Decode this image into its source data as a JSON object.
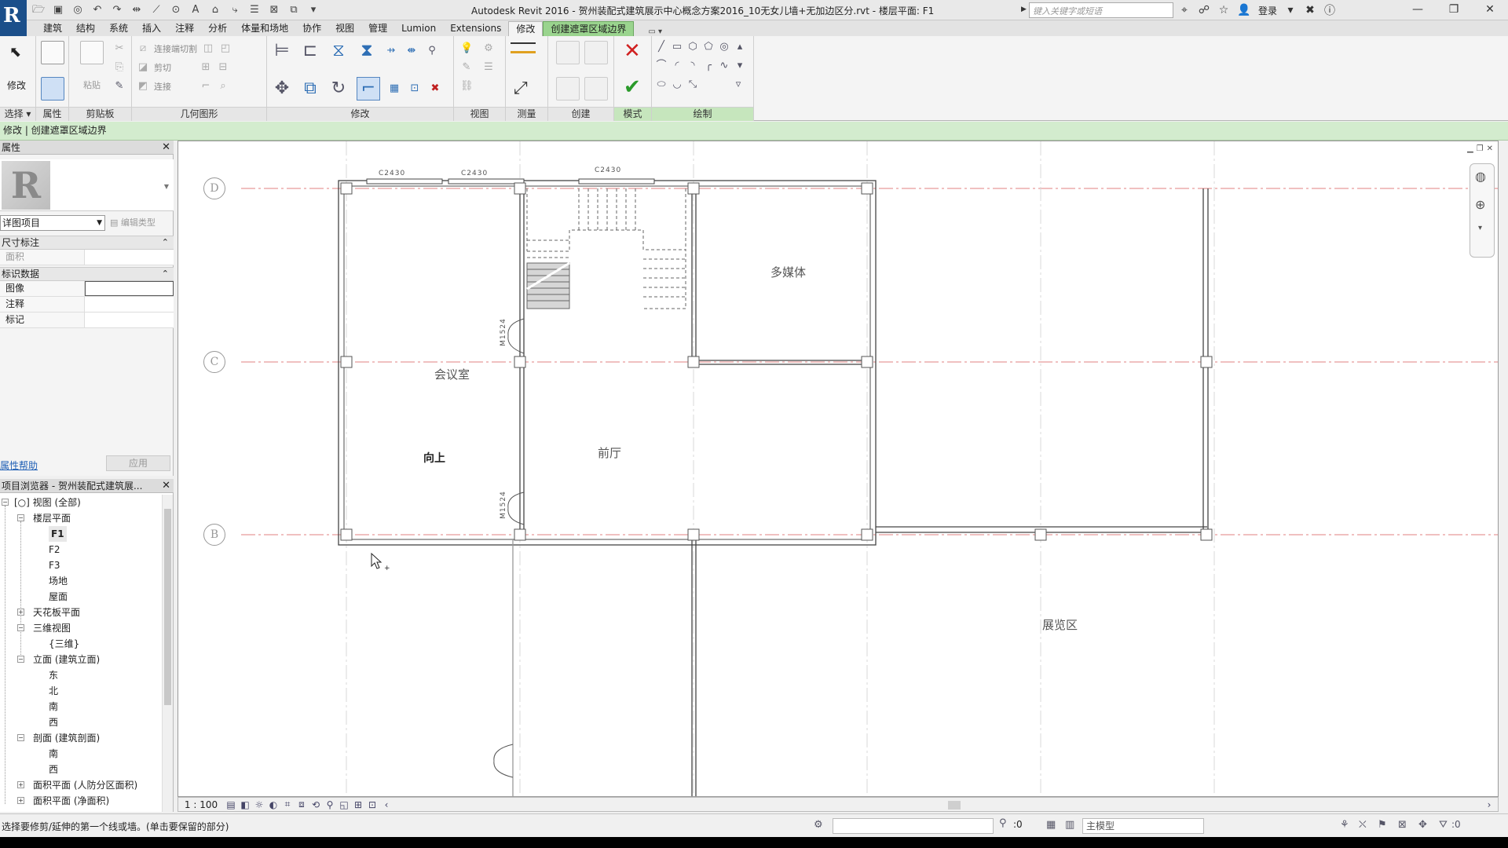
{
  "app": {
    "logo": "R",
    "title": "Autodesk Revit 2016 -    贺州装配式建筑展示中心概念方案2016_10无女儿墙+无加边区分.rvt - 楼层平面: F1",
    "search_placeholder": "键入关键字或短语",
    "login": "登录"
  },
  "ribbon_tabs": [
    {
      "label": "建筑"
    },
    {
      "label": "结构"
    },
    {
      "label": "系统"
    },
    {
      "label": "插入"
    },
    {
      "label": "注释"
    },
    {
      "label": "分析"
    },
    {
      "label": "体量和场地"
    },
    {
      "label": "协作"
    },
    {
      "label": "视图"
    },
    {
      "label": "管理"
    },
    {
      "label": "Lumion"
    },
    {
      "label": "Extensions"
    },
    {
      "label": "修改"
    },
    {
      "label": "创建遮罩区域边界"
    }
  ],
  "ribbon_panels": {
    "select": "选择",
    "select_arrow": "▾",
    "modify": "修改",
    "properties": "属性",
    "clipboard": "剪贴板",
    "paste": "粘贴",
    "geometry": "几何图形",
    "geometry_items": [
      "连接端切割",
      "剪切",
      "连接"
    ],
    "modify_panel": "修改",
    "view": "视图",
    "measure": "测量",
    "create": "创建",
    "mode": "模式",
    "draw": "绘制"
  },
  "context_bar": "修改 | 创建遮罩区域边界",
  "properties": {
    "title": "属性",
    "type_name": "详图项目",
    "edit_type": "编辑类型",
    "group_dims": "尺寸标注",
    "area": "面积",
    "group_identity": "标识数据",
    "image": "图像",
    "comments": "注释",
    "mark": "标记",
    "help": "属性帮助",
    "apply": "应用"
  },
  "browser": {
    "title": "项目浏览器 - 贺州装配式建筑展...",
    "nodes": [
      {
        "label": "视图 (全部)",
        "toggle": "−"
      },
      {
        "label": "楼层平面",
        "toggle": "−"
      },
      {
        "label": "F1"
      },
      {
        "label": "F2"
      },
      {
        "label": "F3"
      },
      {
        "label": "场地"
      },
      {
        "label": "屋面"
      },
      {
        "label": "天花板平面",
        "toggle": "+"
      },
      {
        "label": "三维视图",
        "toggle": "−"
      },
      {
        "label": "{三维}"
      },
      {
        "label": "立面 (建筑立面)",
        "toggle": "−"
      },
      {
        "label": "东"
      },
      {
        "label": "北"
      },
      {
        "label": "南"
      },
      {
        "label": "西"
      },
      {
        "label": "剖面 (建筑剖面)",
        "toggle": "−"
      },
      {
        "label": "南"
      },
      {
        "label": "西"
      },
      {
        "label": "面积平面 (人防分区面积)",
        "toggle": "+"
      },
      {
        "label": "面积平面 (净面积)",
        "toggle": "+"
      }
    ]
  },
  "drawing": {
    "grids": [
      "D",
      "C",
      "B"
    ],
    "rooms": {
      "meeting": "会议室",
      "lobby": "前厅",
      "media": "多媒体",
      "exhibit": "展览区"
    },
    "stair_label": "向上",
    "window_tags": [
      "C2430",
      "C2430",
      "C2430"
    ],
    "door_tags": [
      "M1524",
      "M1524"
    ]
  },
  "view_control": {
    "scale": "1 : 100"
  },
  "status": {
    "prompt": "选择要修剪/延伸的第一个线或墙。(单击要保留的部分)",
    "count": ":0",
    "model": "主模型",
    "filter_count": ":0"
  },
  "colors": {
    "context_tab": "#9ad48e",
    "context_bar": "#d3ecce",
    "grid_line": "#e08080",
    "wall": "#444444"
  }
}
